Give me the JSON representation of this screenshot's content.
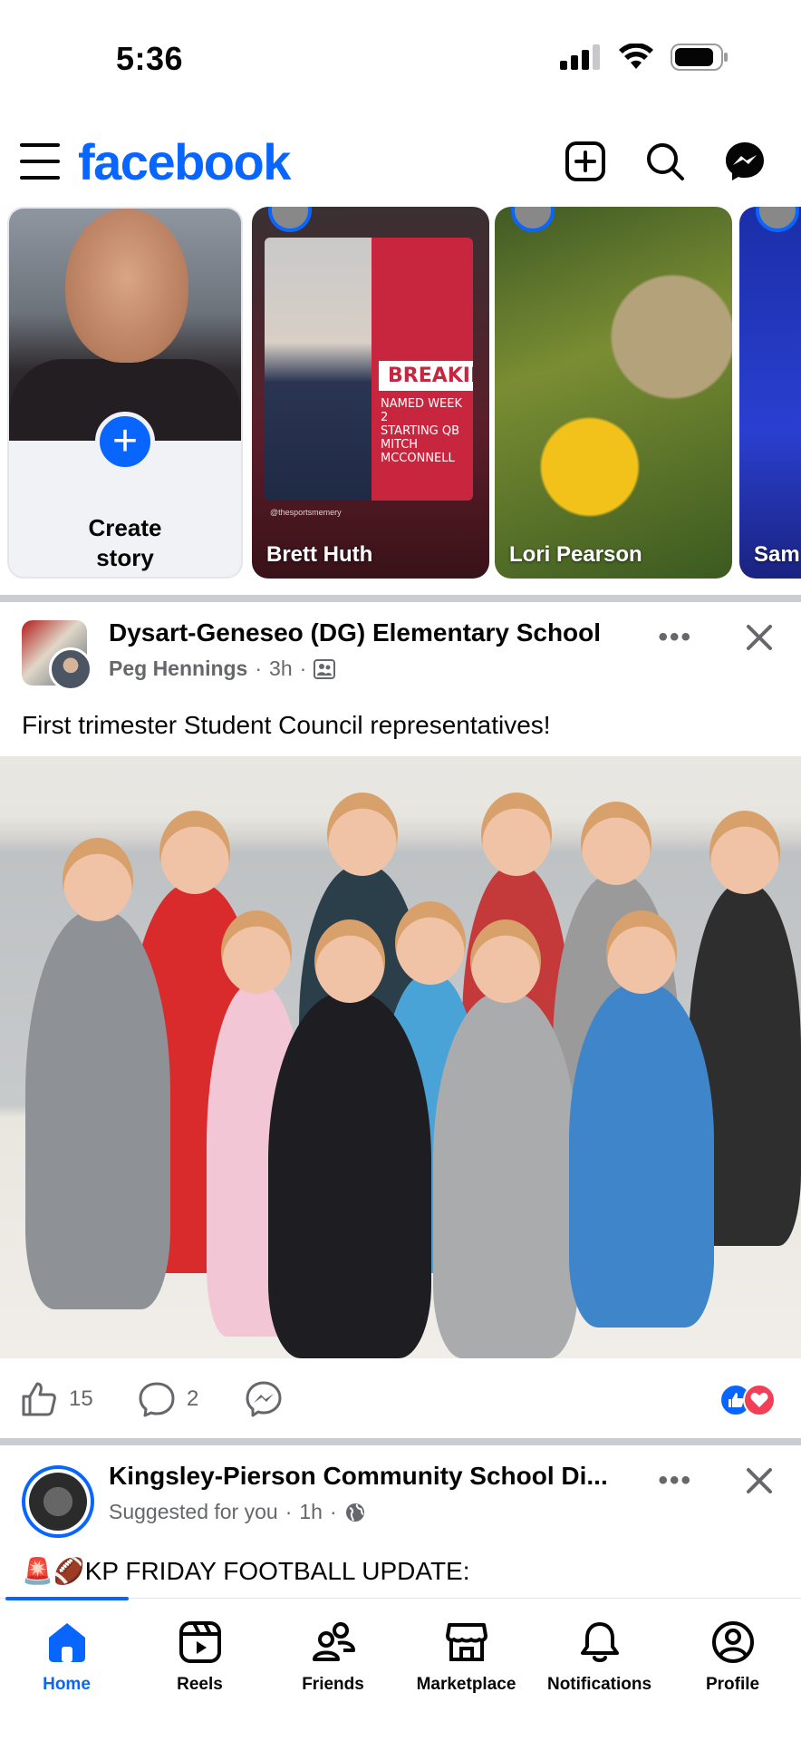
{
  "status_bar": {
    "time": "5:36"
  },
  "header": {
    "logo": "facebook"
  },
  "stories": {
    "create": {
      "label": "Create\nstory"
    },
    "items": [
      {
        "name": "Brett Huth",
        "poster_headline": "BREAKING",
        "poster_sub": "NAMED WEEK 2\nSTARTING QB\nMITCH\nMCCONNELL",
        "watermark": "@thesportsmemery"
      },
      {
        "name": "Lori Pearson"
      },
      {
        "name": "Sam"
      }
    ]
  },
  "posts": [
    {
      "title": "Dysart-Geneseo (DG) Elementary School",
      "author": "Peg Hennings",
      "time": "3h",
      "text": "First trimester Student Council representatives!",
      "likes": "15",
      "comments": "2"
    },
    {
      "title": "Kingsley-Pierson Community School Di...",
      "subtitle": "Suggested for you",
      "time": "1h",
      "text": "🚨🏈KP FRIDAY FOOTBALL UPDATE:"
    }
  ],
  "nav": {
    "items": [
      {
        "label": "Home",
        "active": true
      },
      {
        "label": "Reels"
      },
      {
        "label": "Friends"
      },
      {
        "label": "Marketplace"
      },
      {
        "label": "Notifications"
      },
      {
        "label": "Profile"
      }
    ]
  },
  "colors": {
    "brand": "#0866ff",
    "secondary_text": "#65676b",
    "love": "#f33e58"
  }
}
